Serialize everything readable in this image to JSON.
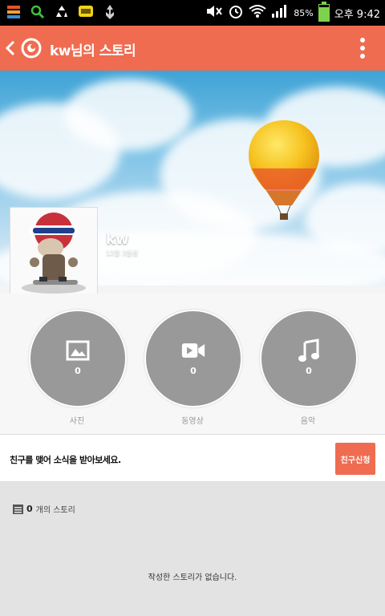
{
  "status_bar": {
    "battery_percent": "85%",
    "battery_level": 0.85,
    "time": "오후 9:42"
  },
  "app_bar": {
    "title": "kw님의 스토리"
  },
  "profile": {
    "name": "kw",
    "date": "12월 3일생"
  },
  "media": [
    {
      "label": "사진",
      "count": "0",
      "icon": "image-icon"
    },
    {
      "label": "동영상",
      "count": "0",
      "icon": "video-icon"
    },
    {
      "label": "음악",
      "count": "0",
      "icon": "music-icon"
    }
  ],
  "friend": {
    "message": "친구를 맺어 소식을 받아보세요.",
    "button_label": "친구신청"
  },
  "stories": {
    "count": "0",
    "count_label": "개의 스토리",
    "empty_message": "작성한 스토리가 없습니다."
  },
  "colors": {
    "accent": "#ef6c50",
    "circle": "#999999"
  }
}
